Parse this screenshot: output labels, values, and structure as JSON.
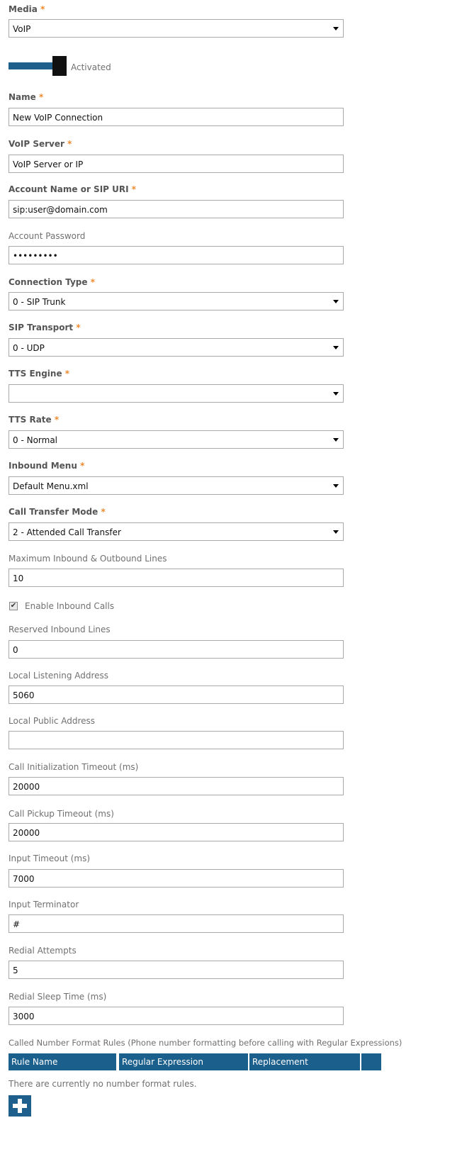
{
  "form": {
    "media": {
      "label": "Media",
      "required": "*",
      "value": "VoIP"
    },
    "activation": {
      "label": "Activated",
      "on": true
    },
    "name": {
      "label": "Name",
      "required": "*",
      "value": "New VoIP Connection"
    },
    "voip_server": {
      "label": "VoIP Server",
      "required": "*",
      "value": "VoIP Server or IP"
    },
    "account_name": {
      "label": "Account Name or SIP URI",
      "required": "*",
      "value": "sip:user@domain.com"
    },
    "account_password": {
      "label": "Account Password",
      "value": "•••••••••"
    },
    "connection_type": {
      "label": "Connection Type",
      "required": "*",
      "value": "0 - SIP Trunk"
    },
    "sip_transport": {
      "label": "SIP Transport",
      "required": "*",
      "value": "0 - UDP"
    },
    "tts_engine": {
      "label": "TTS Engine",
      "required": "*",
      "value": ""
    },
    "tts_rate": {
      "label": "TTS Rate",
      "required": "*",
      "value": "0 - Normal"
    },
    "inbound_menu": {
      "label": "Inbound Menu",
      "required": "*",
      "value": "Default Menu.xml"
    },
    "call_transfer_mode": {
      "label": "Call Transfer Mode",
      "required": "*",
      "value": "2 - Attended Call Transfer"
    },
    "max_lines": {
      "label": "Maximum Inbound & Outbound Lines",
      "value": "10"
    },
    "enable_inbound": {
      "label": "Enable Inbound Calls",
      "checked": true,
      "mark": "✔"
    },
    "reserved_inbound": {
      "label": "Reserved Inbound Lines",
      "value": "0"
    },
    "local_listening": {
      "label": "Local Listening Address",
      "value": "5060"
    },
    "local_public": {
      "label": "Local Public Address",
      "value": ""
    },
    "call_init_timeout": {
      "label": "Call Initialization Timeout (ms)",
      "value": "20000"
    },
    "call_pickup_timeout": {
      "label": "Call Pickup Timeout (ms)",
      "value": "20000"
    },
    "input_timeout": {
      "label": "Input Timeout (ms)",
      "value": "7000"
    },
    "input_terminator": {
      "label": "Input Terminator",
      "value": "#"
    },
    "redial_attempts": {
      "label": "Redial Attempts",
      "value": "5"
    },
    "redial_sleep": {
      "label": "Redial Sleep Time (ms)",
      "value": "3000"
    }
  },
  "rules": {
    "caption": "Called Number Format Rules (Phone number formatting before calling with Regular Expressions)",
    "columns": [
      "Rule Name",
      "Regular Expression",
      "Replacement",
      ""
    ],
    "empty_message": "There are currently no number format rules.",
    "add_icon": "plus-icon"
  },
  "colors": {
    "accent": "#1f5f8b",
    "required_star": "#ee8a2e",
    "header_bg": "#1b5f8c"
  }
}
